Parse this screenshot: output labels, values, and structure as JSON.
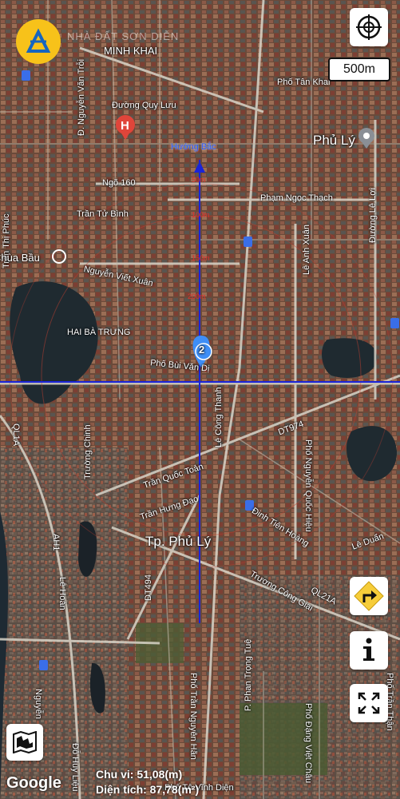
{
  "watermark": "NHÀ ĐẤT SƠN DIỄN",
  "scale_label": "500m",
  "attribution": "Google",
  "measure": {
    "perimeter": "Chu vi: 51,08(m)",
    "area": "Diện tích: 87,78(m²)"
  },
  "labels": {
    "minh_khai": "MINH KHAI",
    "pho_tan_khai": "Phố Tân Khai",
    "phu_ly_top": "Phủ Lý",
    "nguyen_van_troi": "Đ. Nguyễn Văn Trỗi",
    "duong_quy_luu": "Đường Quy Lưu",
    "huong_bac": "Hướng Bắc",
    "ngo_160": "Ngõ 160",
    "tran_tu_binh": "Trần Tử Bình",
    "pham_ngoc_thach": "Phạm Ngọc Thạch",
    "le_loi": "Đường Lê Lợi",
    "tran_thi_phuc": "Trần Thị Phúc",
    "chua_bau": "Chùa Bầu",
    "nguyen_viet_xuan": "Nguyễn Viết Xuân",
    "le_anh_xuan": "Lê Anh Xuân",
    "hai_ba_trung": "HAI BÀ TRƯNG",
    "pho_bui_van_di": "Phố Bùi Văn Dị",
    "le_cong_thanh": "Lê Công Thanh",
    "dt974": "DT974",
    "ql1a": "QL1A",
    "truong_chinh": "Trường Chinh",
    "tran_quoc_toan": "Trần Quốc Toản",
    "tran_hung_dao": "Trần Hưng Đạo",
    "pho_nguyen_quoc_hieu": "Phố Nguyễn Quốc Hiệu",
    "le_duan": "Lê Duẩn",
    "tp_phu_ly": "Tp. Phủ Lý",
    "dinh_tien_hoang": "Đinh Tiên Hoàng",
    "ah1": "AH1",
    "le_hoan": "Lê Hoàn",
    "dt494": "DT494",
    "ql21a": "QL21A",
    "truong_cong_giai": "Trương Công Giai",
    "p_phan_trong_tue": "P. Phan Trọng Tuệ",
    "pho_tran_nguyen_han": "Phố Trần Nguyên Hãn",
    "pho_dang_viet_chau": "Phố Đặng Việt Châu",
    "pho_to_vinh_dien": "Phố Tô Vĩnh Diện",
    "do_huy_lieu": "Đỗ Huy Liệu",
    "nguyen": "Nguyễn",
    "tran_than": "Phố Trần Thận",
    "marker_2": "2"
  },
  "icons": {
    "locate": "crosshair-icon",
    "directions": "turn-right-icon",
    "info": "info-icon",
    "fullscreen": "fullscreen-icon",
    "map_type": "map-icon",
    "hospital": "hospital-icon",
    "pin": "location-pin-icon"
  },
  "colors": {
    "crosshair_line": "#1a24d8",
    "marker_blue": "#3e8ef7",
    "directions_diamond": "#f6cd3a"
  }
}
